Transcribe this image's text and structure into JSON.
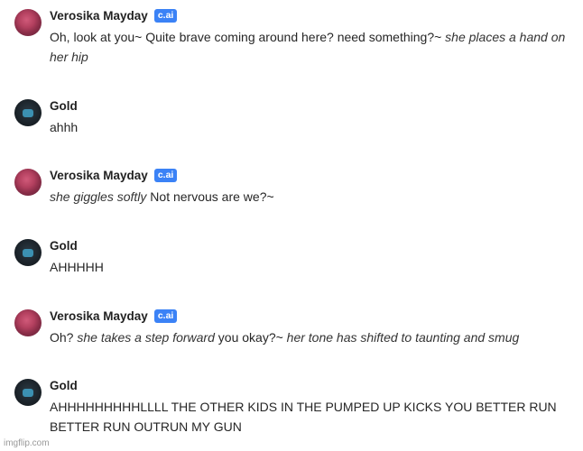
{
  "badge_label": "c.ai",
  "watermark": "imgflip.com",
  "messages": [
    {
      "author": "Verosika Mayday",
      "role": "character",
      "parts": [
        {
          "t": "Oh, look at you~ Quite brave coming around here? need something?~ ",
          "i": false
        },
        {
          "t": "she places a hand on her hip",
          "i": true
        }
      ]
    },
    {
      "author": "Gold",
      "role": "user",
      "parts": [
        {
          "t": "ahhh",
          "i": false
        }
      ]
    },
    {
      "author": "Verosika Mayday",
      "role": "character",
      "parts": [
        {
          "t": "she giggles softly",
          "i": true
        },
        {
          "t": " Not nervous are we?~",
          "i": false
        }
      ]
    },
    {
      "author": "Gold",
      "role": "user",
      "parts": [
        {
          "t": "AHHHHH",
          "i": false
        }
      ]
    },
    {
      "author": "Verosika Mayday",
      "role": "character",
      "parts": [
        {
          "t": "Oh? ",
          "i": false
        },
        {
          "t": "she takes a step forward",
          "i": true
        },
        {
          "t": " you okay?~ ",
          "i": false
        },
        {
          "t": "her tone has shifted to taunting and smug",
          "i": true
        }
      ]
    },
    {
      "author": "Gold",
      "role": "user",
      "parts": [
        {
          "t": "AHHHHHHHHHLLLL THE OTHER KIDS IN THE PUMPED UP KICKS YOU BETTER RUN BETTER RUN OUTRUN MY GUN",
          "i": false
        }
      ]
    }
  ]
}
